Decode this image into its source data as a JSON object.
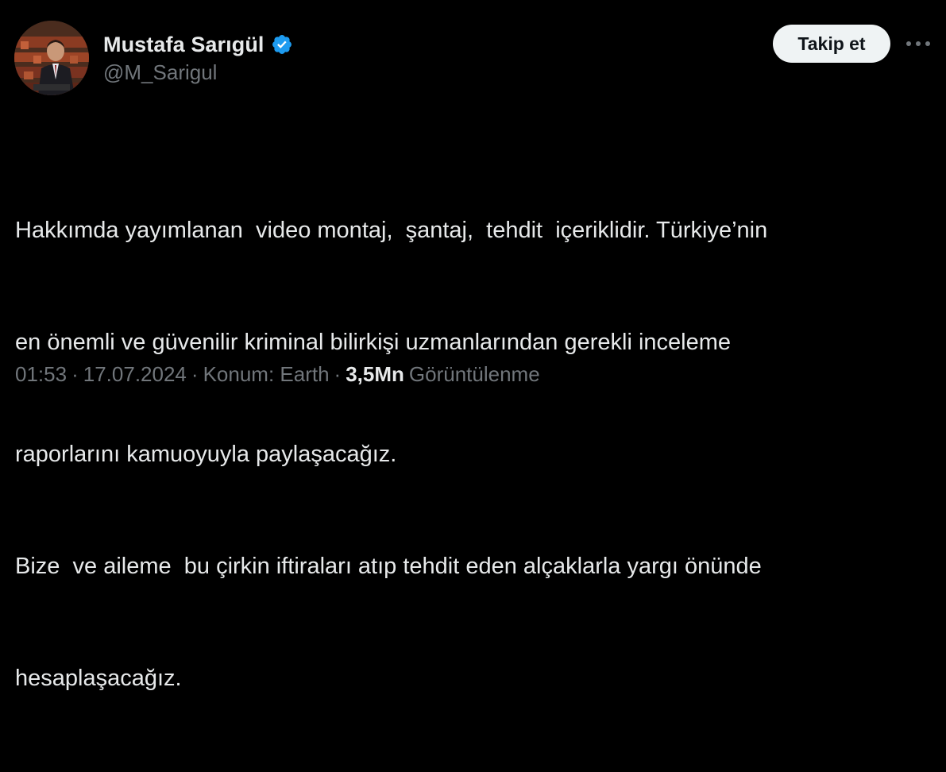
{
  "user": {
    "display_name": "Mustafa Sarıgül",
    "handle": "@M_Sarigul",
    "verified": true,
    "verified_color": "#1d9bf0",
    "avatar_icon": "profile-photo"
  },
  "actions": {
    "follow_label": "Takip et",
    "more_icon": "more-horizontal-icon"
  },
  "tweet": {
    "lines": [
      "Hakkımda yayımlanan  video montaj,  şantaj,  tehdit  içeriklidir. Türkiye’nin",
      "en önemli ve güvenilir kriminal bilirkişi uzmanlarından gerekli inceleme",
      "raporlarını kamuoyuyla paylaşacağız.",
      "Bize  ve aileme  bu çirkin iftiraları atıp tehdit eden alçaklarla yargı önünde",
      "hesaplaşacağız."
    ]
  },
  "meta": {
    "time": "01:53",
    "date": "17.07.2024",
    "location": "Konum: Earth",
    "views_count": "3,5Mn",
    "views_label": "Görüntülenme",
    "separator": "·"
  },
  "colors": {
    "background": "#000000",
    "text_primary": "#e7e9ea",
    "text_secondary": "#71767b",
    "button_bg": "#eff3f4"
  }
}
